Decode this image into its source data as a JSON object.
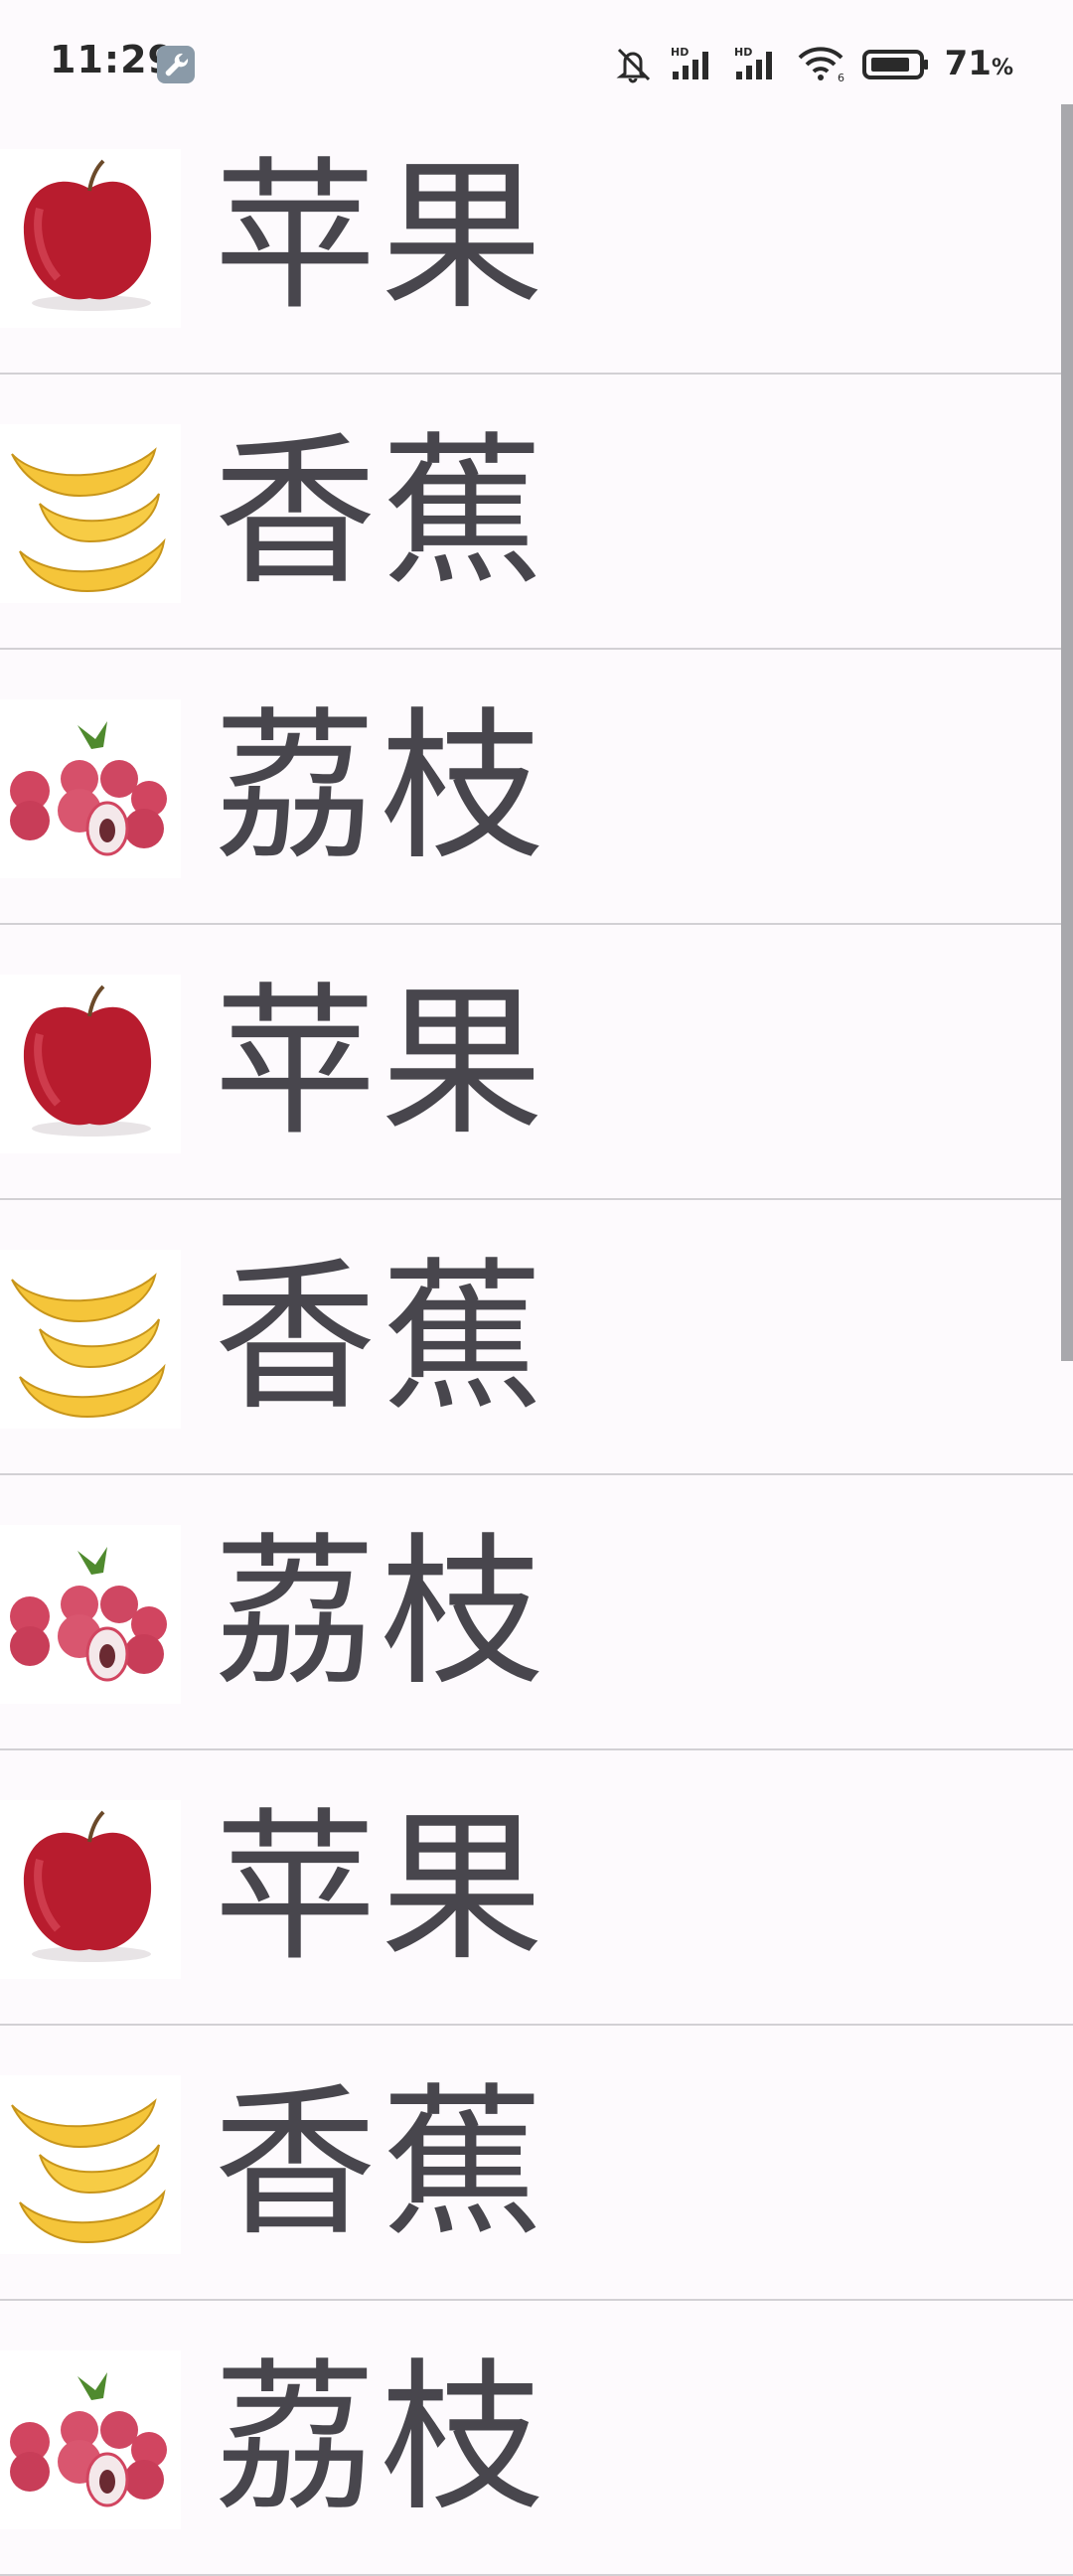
{
  "status_bar": {
    "time": "11:29",
    "battery_percent": "71",
    "battery_unit": "%",
    "icons": [
      "wrench-icon",
      "mute-icon",
      "hd-signal-icon",
      "hd-signal-icon",
      "wifi-icon",
      "battery-icon"
    ]
  },
  "list": {
    "items": [
      {
        "label": "苹果",
        "icon": "apple"
      },
      {
        "label": "香蕉",
        "icon": "banana"
      },
      {
        "label": "荔枝",
        "icon": "lychee"
      },
      {
        "label": "苹果",
        "icon": "apple"
      },
      {
        "label": "香蕉",
        "icon": "banana"
      },
      {
        "label": "荔枝",
        "icon": "lychee"
      },
      {
        "label": "苹果",
        "icon": "apple"
      },
      {
        "label": "香蕉",
        "icon": "banana"
      },
      {
        "label": "荔枝",
        "icon": "lychee"
      }
    ]
  },
  "colors": {
    "background": "#fdfafd",
    "text": "#48464d",
    "divider": "#d2d0d4",
    "scrollbar": "#a8a8ac"
  }
}
